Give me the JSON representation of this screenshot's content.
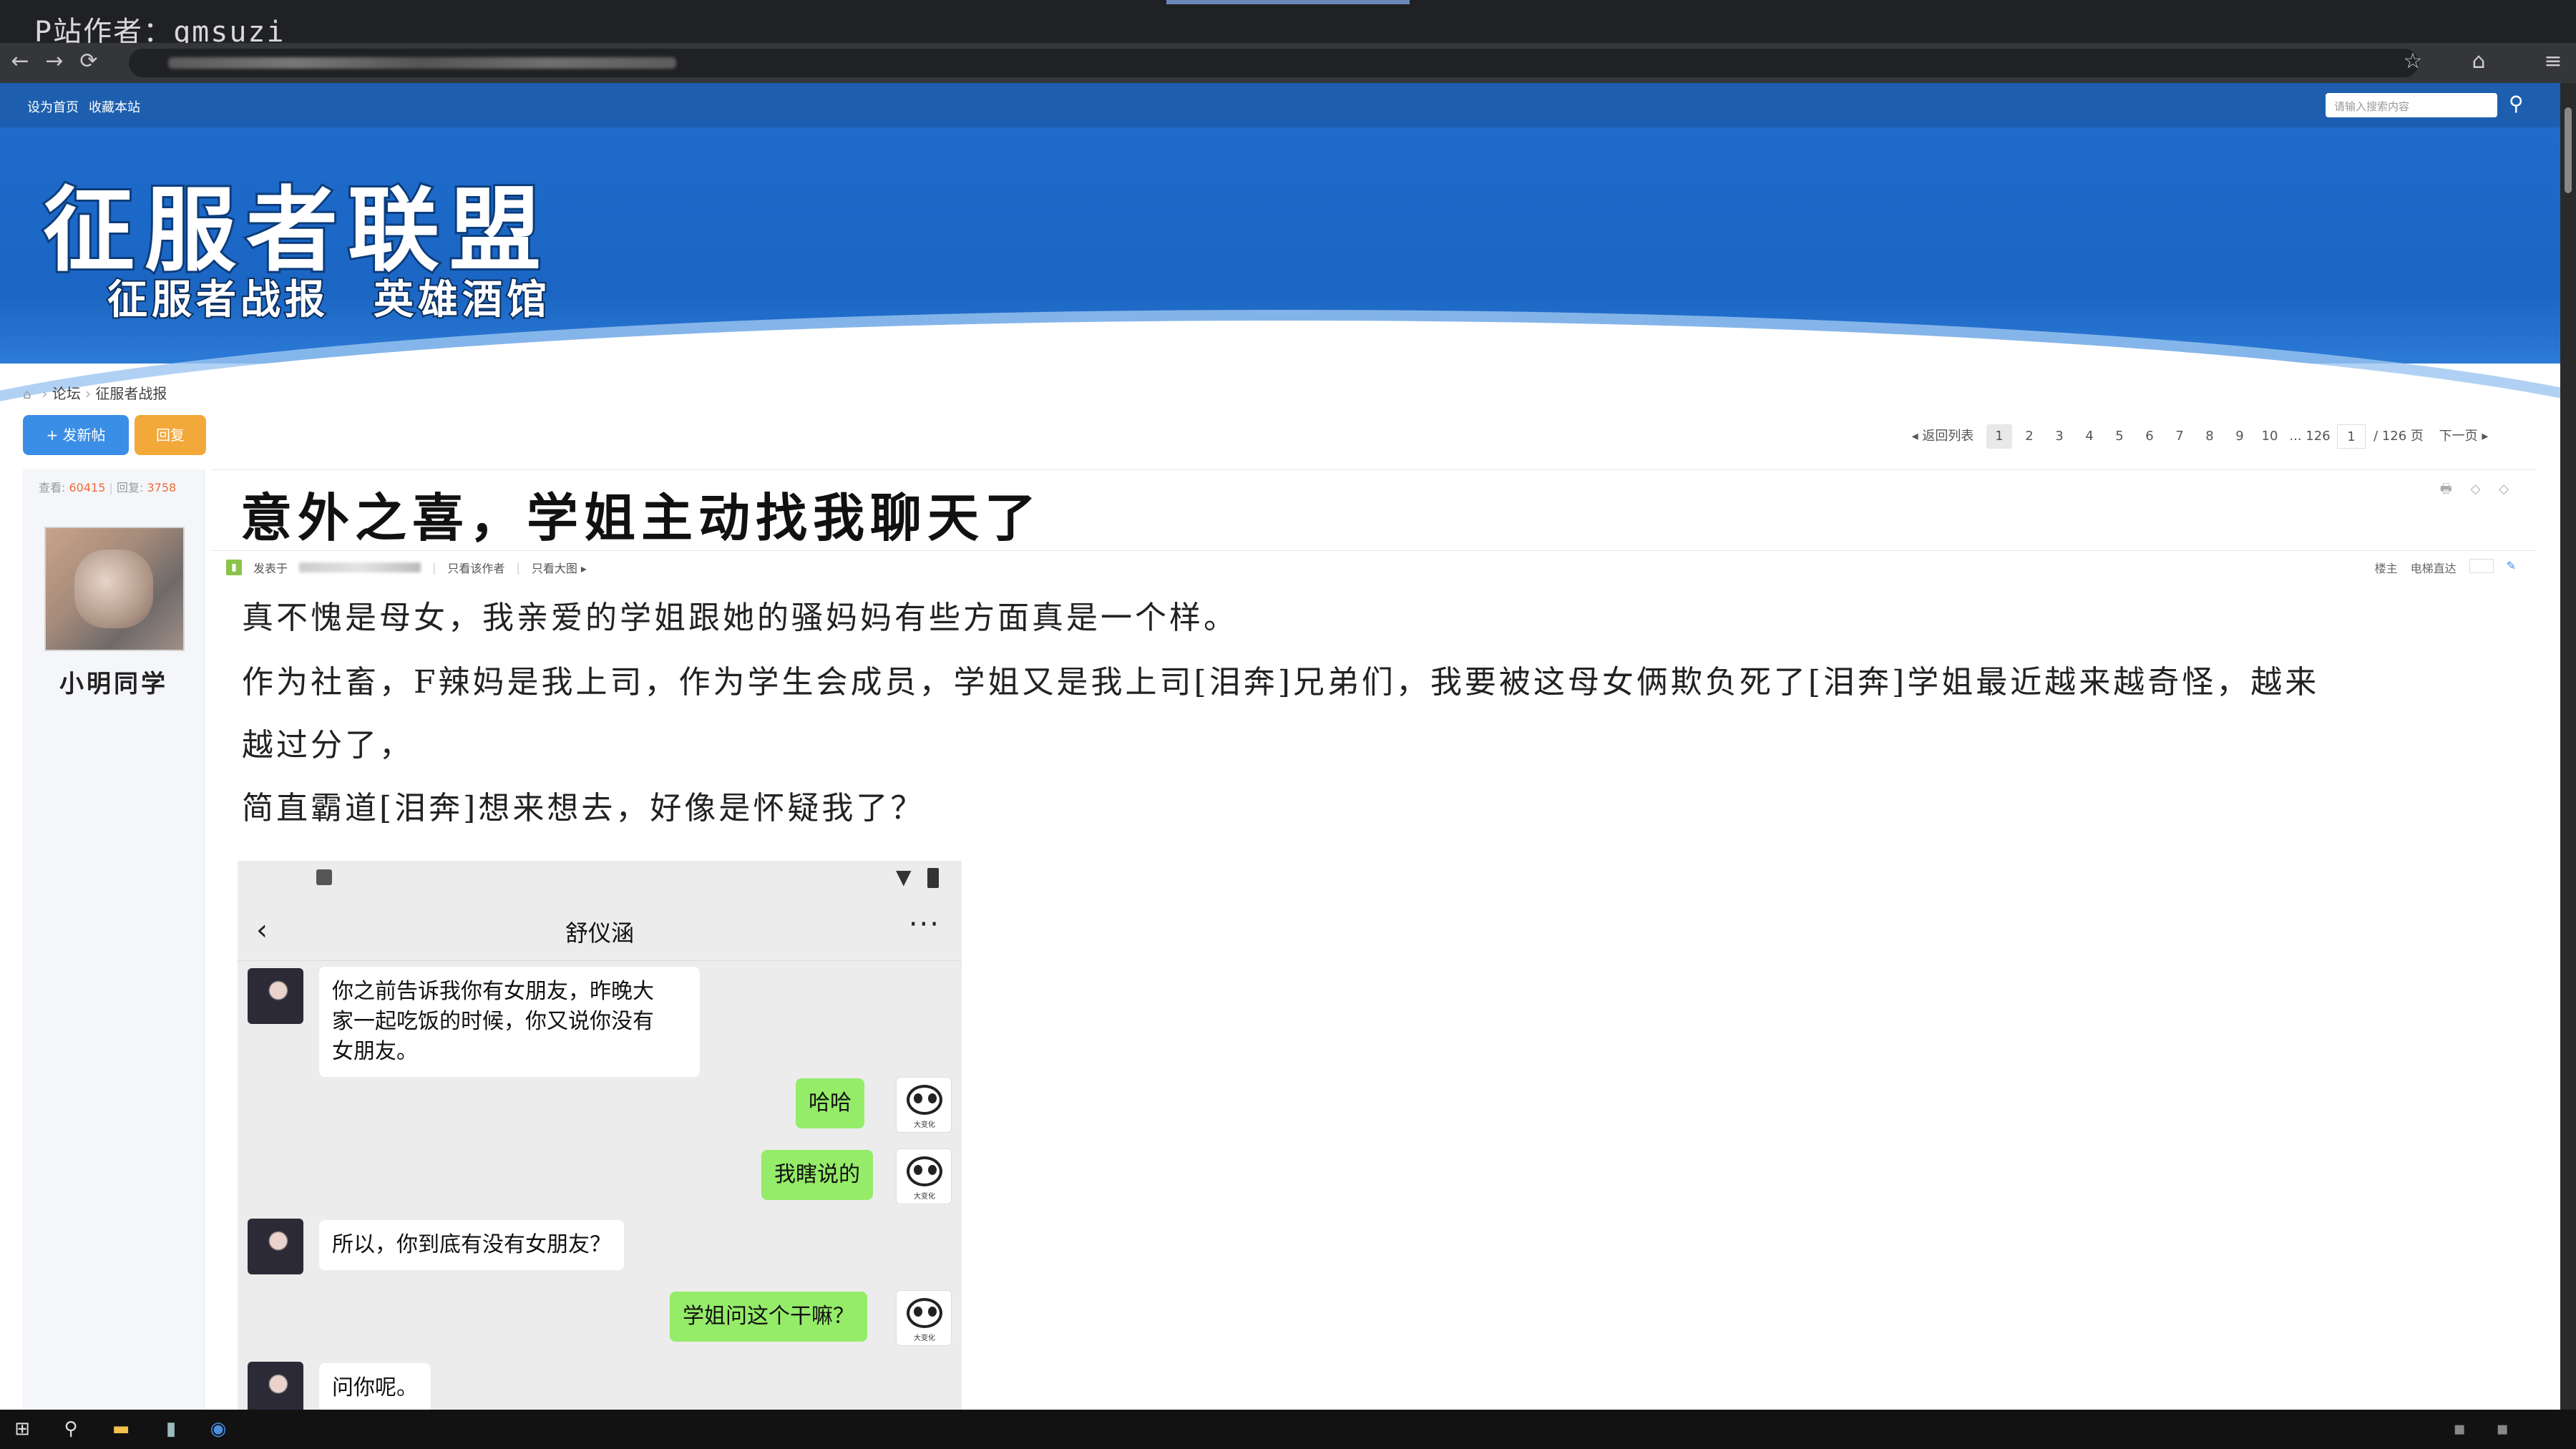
{
  "overlay": {
    "watermark": "P站作者：qmsuzi"
  },
  "browser": {
    "back": "←",
    "forward": "→",
    "reload": "⟳"
  },
  "topbar": {
    "set_home": "设为首页",
    "bookmark": "收藏本站",
    "search_placeholder": "请输入搜索内容"
  },
  "banner": {
    "title": "征服者联盟",
    "subtitle": "征服者战报　英雄酒馆"
  },
  "breadcrumb": {
    "forum": "论坛",
    "board": "征服者战报"
  },
  "actions": {
    "new_post": "+ 发新帖",
    "reply": "回复"
  },
  "pager": {
    "back_to_list": "◂ 返回列表",
    "pages": [
      "1",
      "2",
      "3",
      "4",
      "5",
      "6",
      "7",
      "8",
      "9",
      "10",
      "... 126"
    ],
    "current_input": "1",
    "total": "/ 126 页",
    "next": "下一页 ▸"
  },
  "author": {
    "views_label": "查看:",
    "views": "60415",
    "replies_label": "回复:",
    "replies": "3758",
    "name": "小明同学"
  },
  "post": {
    "title": "意外之喜，学姐主动找我聊天了",
    "meta_posted": "发表于",
    "meta_only_author": "只看该作者",
    "meta_big_image": "只看大图 ▸",
    "meta_right_floor": "楼主",
    "meta_right_jump": "电梯直达",
    "paragraphs": [
      "真不愧是母女，我亲爱的学姐跟她的骚妈妈有些方面真是一个样。",
      "作为社畜，F辣妈是我上司，作为学生会成员，学姐又是我上司[泪奔]兄弟们，我要被这母女俩欺负死了[泪奔]学姐最近越来越奇怪，越来",
      "越过分了，",
      "简直霸道[泪奔]想来想去，好像是怀疑我了？"
    ]
  },
  "chat": {
    "contact": "舒仪涵",
    "more": "···",
    "my_avatar_tag": "大变化",
    "messages": [
      {
        "from": "her",
        "text_lines": [
          "你之前告诉我你有女朋友，昨晚大",
          "家一起吃饭的时候，你又说你没有",
          "女朋友。"
        ]
      },
      {
        "from": "me",
        "text": "哈哈"
      },
      {
        "from": "me",
        "text": "我瞎说的"
      },
      {
        "from": "her",
        "text": "所以，你到底有没有女朋友？"
      },
      {
        "from": "me",
        "text": "学姐问这个干嘛？"
      },
      {
        "from": "her",
        "text": "问你呢。"
      }
    ]
  },
  "colors": {
    "site_blue": "#1d5fae",
    "new_post_button": "#3a8ee6",
    "reply_button": "#f3a83a",
    "chat_bubble_me": "#95ec69"
  }
}
